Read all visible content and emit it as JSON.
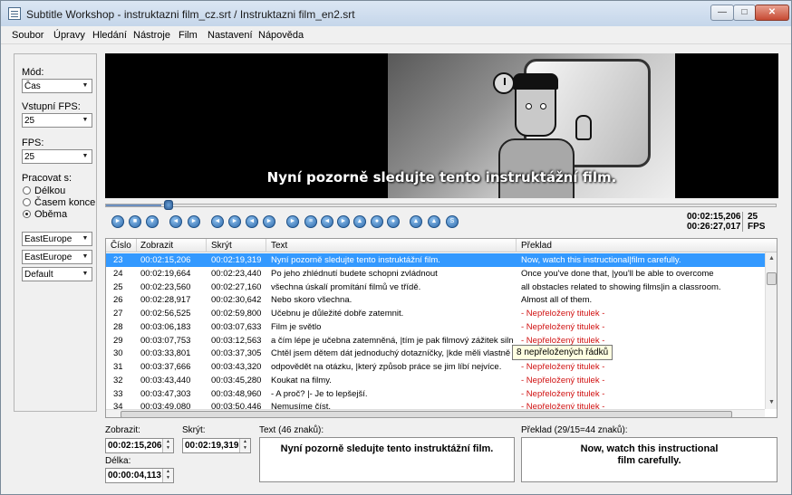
{
  "window": {
    "title": "Subtitle Workshop - instruktazni film_cz.srt / Instruktazni film_en2.srt",
    "controls": {
      "minimize": "—",
      "maximize": "□",
      "close": "✕"
    }
  },
  "menu": [
    "Soubor",
    "Úpravy",
    "Hledání",
    "Nástroje",
    "Film",
    "Nastavení",
    "Nápověda"
  ],
  "sidebar": {
    "mode_label": "Mód:",
    "mode_value": "Čas",
    "input_fps_label": "Vstupní FPS:",
    "input_fps_value": "25",
    "fps_label": "FPS:",
    "fps_value": "25",
    "work_with_label": "Pracovat s:",
    "radio_options": [
      "Délkou",
      "Časem konce",
      "Oběma"
    ],
    "radio_selected": "Oběma",
    "charset_1": "EastEurope",
    "charset_2": "EastEurope",
    "style": "Default"
  },
  "video": {
    "subtitle_overlay": "Nyní pozorně sledujte tento instruktážní film.",
    "seek_position_fraction": 0.082
  },
  "toolbar": {
    "icons": [
      "play-icon",
      "pause-icon",
      "stop-icon",
      "rewind-icon",
      "forward-icon",
      "prev-subtitle-icon",
      "next-subtitle-icon",
      "back-icon",
      "fast-forward-icon",
      "end-icon",
      "set-start-icon",
      "set-end-icon",
      "mark-start-icon",
      "mark-end-icon",
      "sync-icon",
      "jump-icon",
      "insert-icon",
      "save-icon",
      "snapshot-icon"
    ],
    "current_time": "00:02:15,206",
    "total_time": "00:26:27,017",
    "fps_value": "25",
    "fps_unit": "FPS"
  },
  "grid": {
    "columns": [
      "Číslo",
      "Zobrazit",
      "Skrýt",
      "Text",
      "Překlad"
    ],
    "rows": [
      {
        "num": "23",
        "show": "00:02:15,206",
        "hide": "00:02:19,319",
        "text": "Nyní pozorně sledujte tento instruktážní film.",
        "translation": "Now, watch this instructional|film carefully.",
        "selected": true,
        "untranslated": false
      },
      {
        "num": "24",
        "show": "00:02:19,664",
        "hide": "00:02:23,440",
        "text": "Po jeho zhlédnutí budete schopni zvládnout",
        "translation": "Once you've done that, |you'll be able to overcome",
        "selected": false,
        "untranslated": false
      },
      {
        "num": "25",
        "show": "00:02:23,560",
        "hide": "00:02:27,160",
        "text": "všechna úskalí promítání filmů ve třídě.",
        "translation": "all obstacles related to showing films|in a classroom.",
        "selected": false,
        "untranslated": false
      },
      {
        "num": "26",
        "show": "00:02:28,917",
        "hide": "00:02:30,642",
        "text": "Nebo skoro všechna.",
        "translation": "Almost all of them.",
        "selected": false,
        "untranslated": false
      },
      {
        "num": "27",
        "show": "00:02:56,525",
        "hide": "00:02:59,800",
        "text": "Učebnu je důležité dobře zatemnit.",
        "translation": "- Nepřeložený titulek -",
        "selected": false,
        "untranslated": true
      },
      {
        "num": "28",
        "show": "00:03:06,183",
        "hide": "00:03:07,633",
        "text": "Film je světlo",
        "translation": "- Nepřeložený titulek -",
        "selected": false,
        "untranslated": true
      },
      {
        "num": "29",
        "show": "00:03:07,753",
        "hide": "00:03:12,563",
        "text": "a čím lépe je učebna zatemněná, |tím je pak filmový zážitek silnější.",
        "translation": "- Nepřeložený titulek -",
        "selected": false,
        "untranslated": true
      },
      {
        "num": "30",
        "show": "00:03:33,801",
        "hide": "00:03:37,305",
        "text": "Chtěl jsem dětem dát jednoduchý dotazníčky, |kde měli vlastně",
        "translation": "- Nepřeložený titulek -",
        "selected": false,
        "untranslated": true
      },
      {
        "num": "31",
        "show": "00:03:37,666",
        "hide": "00:03:43,320",
        "text": "odpovědět na otázku, |který způsob práce se jim líbí nejvíce.",
        "translation": "- Nepřeložený titulek -",
        "selected": false,
        "untranslated": true
      },
      {
        "num": "32",
        "show": "00:03:43,440",
        "hide": "00:03:45,280",
        "text": "Koukat na filmy.",
        "translation": "- Nepřeložený titulek -",
        "selected": false,
        "untranslated": true
      },
      {
        "num": "33",
        "show": "00:03:47,303",
        "hide": "00:03:48,960",
        "text": "- A proč? |- Je to lepšejší.",
        "translation": "- Nepřeložený titulek -",
        "selected": false,
        "untranslated": true
      },
      {
        "num": "34",
        "show": "00:03:49,080",
        "hide": "00:03:50,446",
        "text": "Nemusíme číst.",
        "translation": "- Nepřeložený titulek -",
        "selected": false,
        "untranslated": true
      }
    ],
    "tooltip": "8 nepřeložených řádků"
  },
  "editor": {
    "show_label": "Zobrazit:",
    "show_value": "00:02:15,206",
    "hide_label": "Skrýt:",
    "hide_value": "00:02:19,319",
    "duration_label": "Délka:",
    "duration_value": "00:00:04,113",
    "text_label": "Text (46 znaků):",
    "text_value": "Nyní pozorně sledujte tento instruktážní film.",
    "translation_label": "Překlad (29/15=44 znaků):",
    "translation_line_1": "Now, watch this instructional",
    "translation_line_2": "film carefully."
  }
}
